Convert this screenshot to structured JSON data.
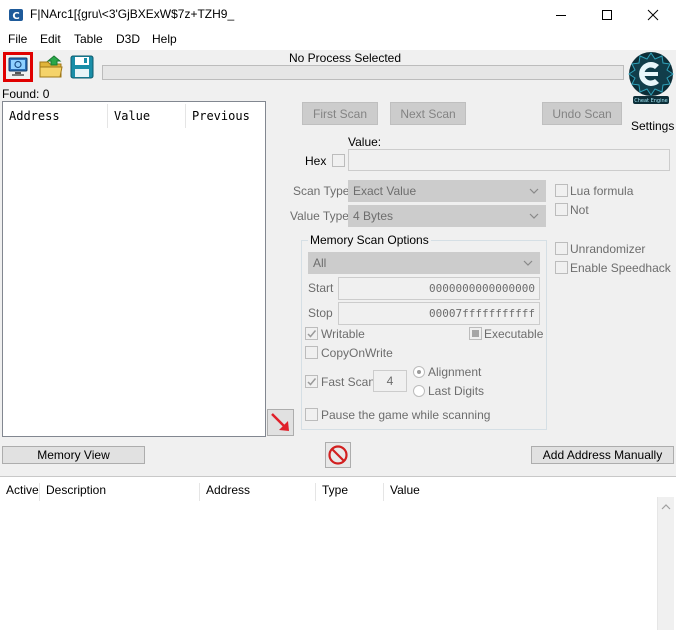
{
  "window": {
    "title": "F|NArc1[{gru\\<3'GjBXExW$7z+TZH9_"
  },
  "menu": [
    "File",
    "Edit",
    "Table",
    "D3D",
    "Help"
  ],
  "toolbar": {
    "process_label": "No Process Selected",
    "settings_label": "Settings",
    "logo_caption": "Cheat Engine"
  },
  "found": {
    "label": "Found: 0",
    "columns": [
      "Address",
      "Value",
      "Previous"
    ]
  },
  "scan": {
    "first_scan": "First Scan",
    "next_scan": "Next Scan",
    "undo_scan": "Undo Scan",
    "value_label": "Value:",
    "hex_label": "Hex",
    "scan_type_label": "Scan Type",
    "scan_type_value": "Exact Value",
    "value_type_label": "Value Type",
    "value_type_value": "4 Bytes",
    "lua_formula": "Lua formula",
    "not": "Not",
    "unrandomizer": "Unrandomizer",
    "enable_speedhack": "Enable Speedhack"
  },
  "memory_scan": {
    "title": "Memory Scan Options",
    "region": "All",
    "start_label": "Start",
    "start_value": "0000000000000000",
    "stop_label": "Stop",
    "stop_value": "00007fffffffffff",
    "writable": "Writable",
    "executable": "Executable",
    "copy_on_write": "CopyOnWrite",
    "fast_scan": "Fast Scan",
    "fast_scan_value": "4",
    "alignment": "Alignment",
    "last_digits": "Last Digits",
    "pause_game": "Pause the game while scanning"
  },
  "bottom": {
    "memory_view": "Memory View",
    "add_address": "Add Address Manually"
  },
  "address_list": {
    "columns": [
      "Active",
      "Description",
      "Address",
      "Type",
      "Value"
    ]
  },
  "colors": {
    "selection_border": "#e00000",
    "arrow": "#e0202a",
    "stop_icon": "#d21f1f"
  }
}
